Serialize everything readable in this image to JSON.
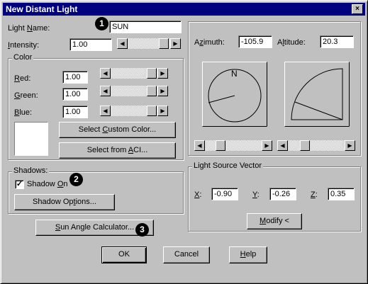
{
  "window": {
    "title": "New Distant Light",
    "close_glyph": "×"
  },
  "light_name": {
    "label": "Light Name:",
    "value": "SUN"
  },
  "intensity": {
    "label": "Intensity:",
    "value": "1.00"
  },
  "color": {
    "group_label": "Color",
    "red": {
      "label": "Red:",
      "value": "1.00"
    },
    "green": {
      "label": "Green:",
      "value": "1.00"
    },
    "blue": {
      "label": "Blue:",
      "value": "1.00"
    },
    "swatch": "#ffffff",
    "select_custom_label": "Select Custom Color...",
    "select_aci_label": "Select from ACI..."
  },
  "shadows": {
    "group_label": "Shadows:",
    "shadow_on_label": "Shadow On",
    "shadow_on_checked": "✓",
    "options_label": "Shadow Options..."
  },
  "sun_angle_label": "Sun Angle Calculator...",
  "angles": {
    "azimuth_label": "Azimuth:",
    "azimuth_value": "-105.9",
    "altitude_label": "Altitude:",
    "altitude_value": "20.3",
    "compass_north": "N"
  },
  "vector": {
    "group_label": "Light Source Vector",
    "x_label": "X:",
    "x_value": "-0.90",
    "y_label": "Y:",
    "y_value": "-0.26",
    "z_label": "Z:",
    "z_value": "0.35",
    "modify_label": "Modify <"
  },
  "buttons": {
    "ok": "OK",
    "cancel": "Cancel",
    "help": "Help"
  },
  "callouts": [
    "1",
    "2",
    "3"
  ],
  "arrows": {
    "left": "◀",
    "right": "▶"
  }
}
